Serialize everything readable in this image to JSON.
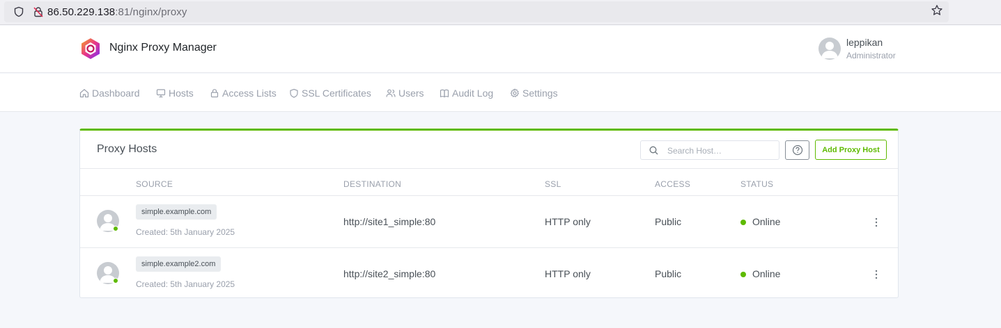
{
  "browser": {
    "url_host": "86.50.229.138",
    "url_rest": ":81/nginx/proxy"
  },
  "header": {
    "brand": "Nginx Proxy Manager",
    "user_name": "leppikan",
    "user_role": "Administrator"
  },
  "nav": [
    {
      "label": "Dashboard",
      "icon": "home-icon"
    },
    {
      "label": "Hosts",
      "icon": "monitor-icon"
    },
    {
      "label": "Access Lists",
      "icon": "lock-icon"
    },
    {
      "label": "SSL Certificates",
      "icon": "shield-icon"
    },
    {
      "label": "Users",
      "icon": "users-icon"
    },
    {
      "label": "Audit Log",
      "icon": "book-icon"
    },
    {
      "label": "Settings",
      "icon": "gear-icon"
    }
  ],
  "card": {
    "title": "Proxy Hosts",
    "search_placeholder": "Search Host…",
    "add_label": "Add Proxy Host",
    "accent_color": "#5eba00"
  },
  "table": {
    "columns": [
      "SOURCE",
      "DESTINATION",
      "SSL",
      "ACCESS",
      "STATUS"
    ],
    "rows": [
      {
        "domain": "simple.example.com",
        "created": "Created: 5th January 2025",
        "destination": "http://site1_simple:80",
        "ssl": "HTTP only",
        "access": "Public",
        "status": "Online"
      },
      {
        "domain": "simple.example2.com",
        "created": "Created: 5th January 2025",
        "destination": "http://site2_simple:80",
        "ssl": "HTTP only",
        "access": "Public",
        "status": "Online"
      }
    ]
  }
}
